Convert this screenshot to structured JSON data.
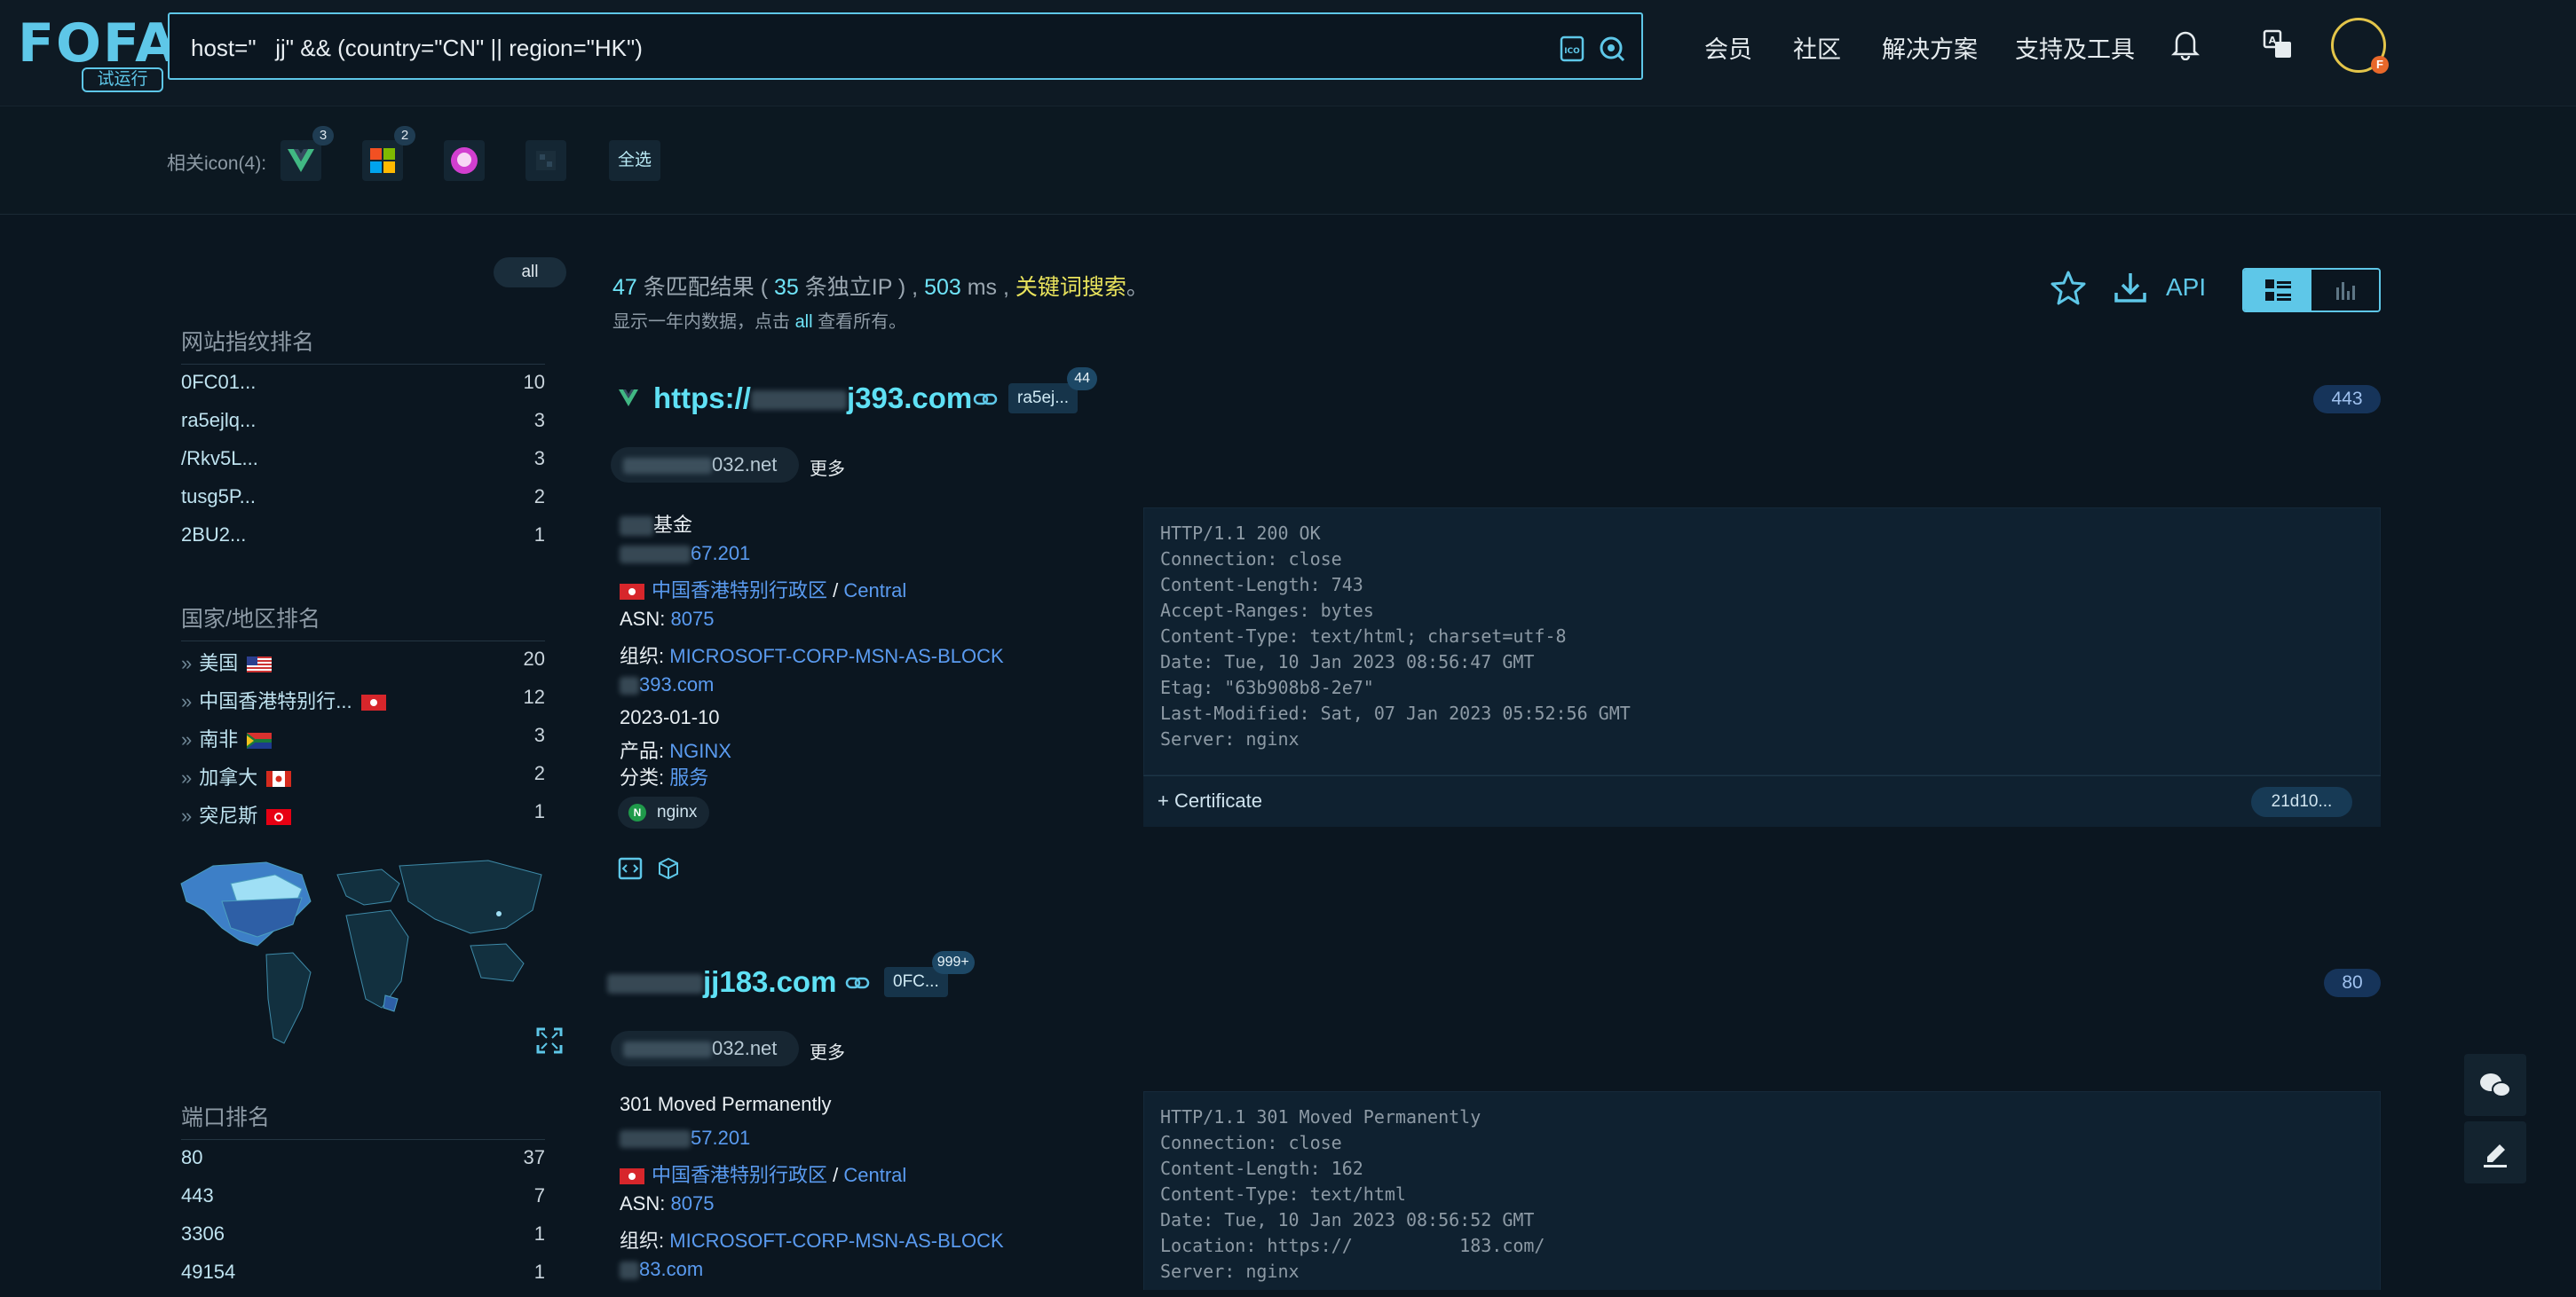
{
  "header": {
    "logo_text": "FOFA",
    "trial_label": "试运行",
    "search_value": "host=\"   jj\" && (country=\"CN\" || region=\"HK\")",
    "nav": [
      "会员",
      "社区",
      "解决方案",
      "支持及工具"
    ],
    "icons": [
      "image-search-icon",
      "search-icon",
      "bell-icon",
      "translate-icon",
      "avatar"
    ],
    "avatar_badge": "F"
  },
  "icon_filter": {
    "label": "相关icon(4):",
    "icons": [
      {
        "name": "vue-icon",
        "badge": "3"
      },
      {
        "name": "windows-icon",
        "badge": "2"
      },
      {
        "name": "unicorn-icon",
        "badge": ""
      },
      {
        "name": "dark-tile-icon",
        "badge": ""
      }
    ],
    "select_all": "全选"
  },
  "sidebar": {
    "all_label": "all",
    "fingerprint": {
      "title": "网站指纹排名",
      "items": [
        {
          "label": "0FC01...",
          "count": "10"
        },
        {
          "label": "ra5ejlq...",
          "count": "3"
        },
        {
          "label": "/Rkv5L...",
          "count": "3"
        },
        {
          "label": "tusg5P...",
          "count": "2"
        },
        {
          "label": "2BU2...",
          "count": "1"
        }
      ]
    },
    "country": {
      "title": "国家/地区排名",
      "items": [
        {
          "label": "美国",
          "count": "20",
          "flag": "us"
        },
        {
          "label": "中国香港特别行...",
          "count": "12",
          "flag": "hk"
        },
        {
          "label": "南非",
          "count": "3",
          "flag": "za"
        },
        {
          "label": "加拿大",
          "count": "2",
          "flag": "ca"
        },
        {
          "label": "突尼斯",
          "count": "1",
          "flag": "tn"
        }
      ]
    },
    "port": {
      "title": "端口排名",
      "items": [
        {
          "label": "80",
          "count": "37"
        },
        {
          "label": "443",
          "count": "7"
        },
        {
          "label": "3306",
          "count": "1"
        },
        {
          "label": "49154",
          "count": "1"
        }
      ]
    }
  },
  "summary": {
    "count": "47",
    "matched_text": "条匹配结果 (",
    "ip_count": "35",
    "ip_text": "条独立IP ) ,",
    "ms": "503",
    "ms_text": "ms ,",
    "keyword": "关键词搜索",
    "end": "。",
    "note_pre": "显示一年内数据，点击",
    "note_link": "all",
    "note_post": "查看所有。"
  },
  "actions": {
    "api_label": "API",
    "star_icon": "star-icon",
    "download_icon": "download-icon"
  },
  "results": [
    {
      "title_prefix": "https://",
      "title_suffix": "j393.com",
      "tag": "ra5ej...",
      "tag_count": "44",
      "port": "443",
      "domain_suffix": "032.net",
      "more": "更多",
      "name": "基金",
      "ip_suffix": "67.201",
      "location": "中国香港特别行政区",
      "city": "Central",
      "asn_label": "ASN:",
      "asn": "8075",
      "org_label": "组织:",
      "org": "MICROSOFT-CORP-MSN-AS-BLOCK",
      "host_suffix": "393.com",
      "date": "2023-01-10",
      "product_label": "产品:",
      "product": "NGINX",
      "category_label": "分类:",
      "category": "服务",
      "badge": "nginx",
      "header_text": "HTTP/1.1 200 OK\nConnection: close\nContent-Length: 743\nAccept-Ranges: bytes\nContent-Type: text/html; charset=utf-8\nDate: Tue, 10 Jan 2023 08:56:47 GMT\nEtag: \"63b908b8-2e7\"\nLast-Modified: Sat, 07 Jan 2023 05:52:56 GMT\nServer: nginx",
      "cert_label": "+ Certificate",
      "cert_hash": "21d10..."
    },
    {
      "title_suffix": "jj183.com",
      "tag": "0FC...",
      "tag_count": "999+",
      "port": "80",
      "domain_suffix": "032.net",
      "more": "更多",
      "name": "301 Moved Permanently",
      "ip_suffix": "57.201",
      "location": "中国香港特别行政区",
      "city": "Central",
      "asn_label": "ASN:",
      "asn": "8075",
      "org_label": "组织:",
      "org": "MICROSOFT-CORP-MSN-AS-BLOCK",
      "host_suffix": "83.com",
      "header_text": "HTTP/1.1 301 Moved Permanently\nConnection: close\nContent-Length: 162\nContent-Type: text/html\nDate: Tue, 10 Jan 2023 08:56:52 GMT\nLocation: https://          183.com/\nServer: nginx"
    }
  ],
  "colors": {
    "accent": "#5ec7e8",
    "background": "#0b1620",
    "keyword": "#e9e35c",
    "link": "#5a9bf0"
  }
}
